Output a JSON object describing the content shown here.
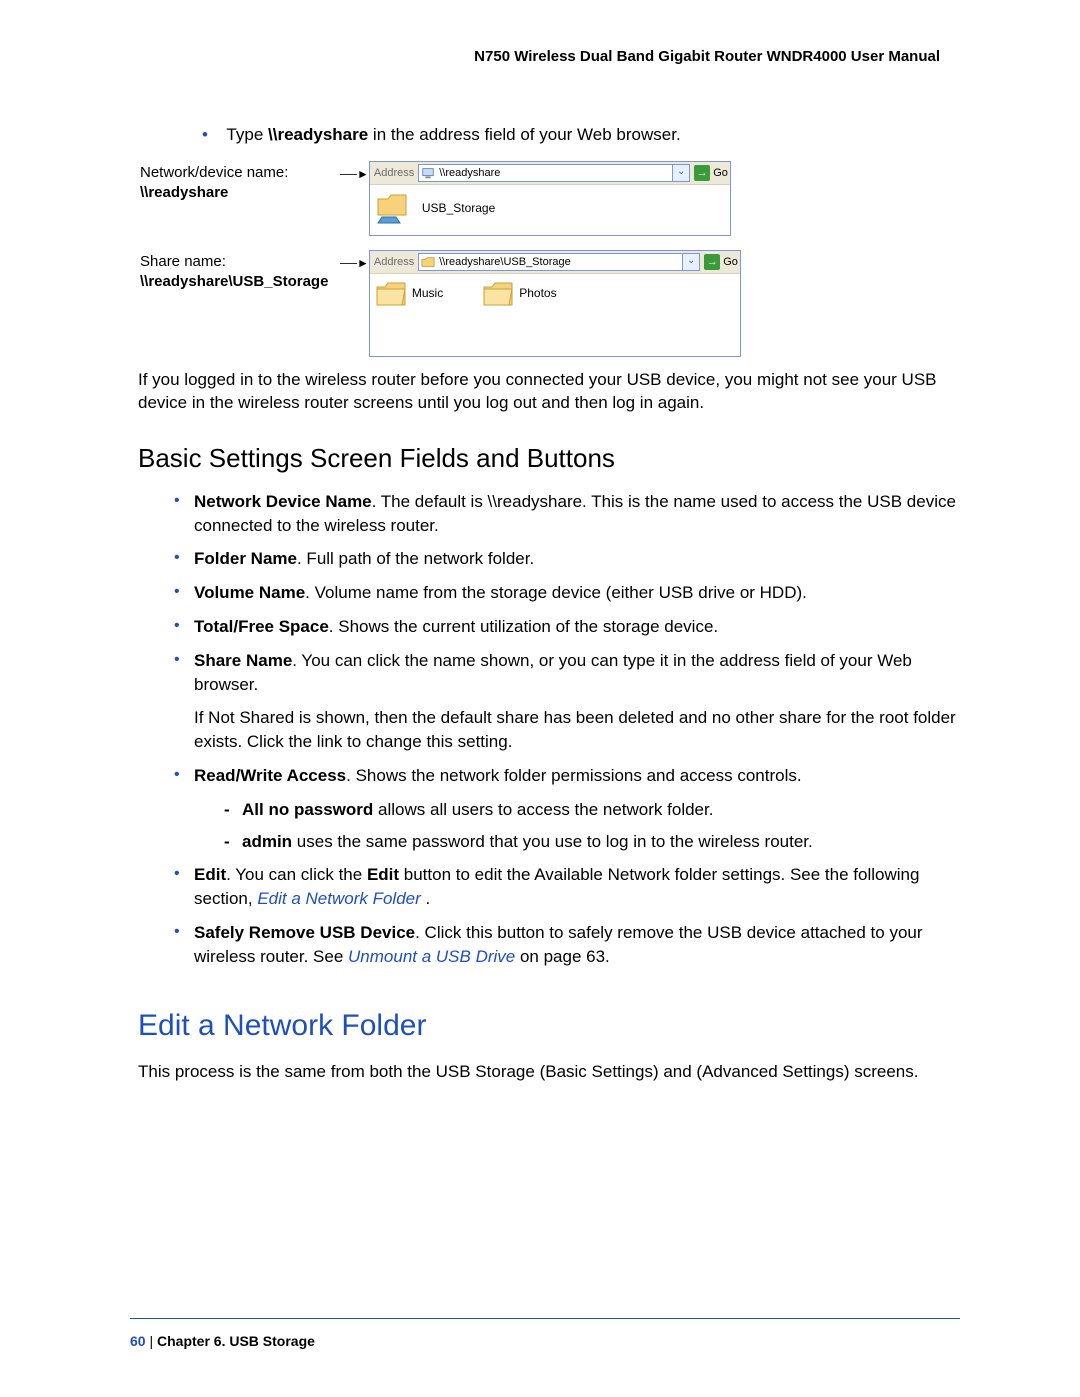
{
  "header": {
    "title": "N750 Wireless Dual Band Gigabit Router WNDR4000 User Manual"
  },
  "intro": {
    "prefix": "Type ",
    "cmd": "\\\\readyshare",
    "suffix": " in the address field of your Web browser."
  },
  "fig1": {
    "label_line1": "Network/device name:",
    "label_line2": "\\\\readyshare",
    "address_label": "Address",
    "address_value": "\\\\readyshare",
    "go": "Go",
    "item": "USB_Storage"
  },
  "fig2": {
    "label_line1": "Share name:",
    "label_line2": "\\\\readyshare\\USB_Storage",
    "address_label": "Address",
    "address_value": "\\\\readyshare\\USB_Storage",
    "go": "Go",
    "item1": "Music",
    "item2": "Photos"
  },
  "post_fig_para": "If you logged in to the wireless router before you connected your USB device, you might not see your USB device in the wireless router screens until you log out and then log in again.",
  "section1": {
    "title": "Basic Settings Screen Fields and Buttons",
    "items": [
      {
        "bold": "Network Device Name",
        "rest": ". The default is \\\\readyshare. This is the name used to access the USB device connected to the wireless router."
      },
      {
        "bold": "Folder Name",
        "rest": ". Full path of the network folder."
      },
      {
        "bold": "Volume Name",
        "rest": ". Volume name from the storage device (either USB drive or HDD)."
      },
      {
        "bold": "Total/Free Space",
        "rest": ". Shows the current utilization of the storage device."
      },
      {
        "bold": "Share Name",
        "rest": ". You can click the name shown, or you can type it in the address field of your Web browser.",
        "subpara": "If Not Shared is shown, then the default share has been deleted and no other share for the root folder exists. Click the link to change this setting."
      },
      {
        "bold": "Read/Write Access",
        "rest": ". Shows the network folder permissions and access controls.",
        "dashes": [
          {
            "bold": "All no password",
            "rest": " allows all users to access the network folder."
          },
          {
            "bold": "admin",
            "rest": " uses the same password that you use to log in to the wireless router."
          }
        ]
      },
      {
        "bold": "Edit",
        "rest_pre": ". You can click the ",
        "rest_bold": "Edit",
        "rest_mid": " button to edit the Available Network folder settings. See the following section, ",
        "link": "Edit a Network Folder ",
        "rest_post": "."
      },
      {
        "bold": "Safely Remove USB Device",
        "rest_pre": ". Click this button to safely remove the USB device attached to your wireless router. See ",
        "link": "Unmount a USB Drive",
        "rest_post": " on page 63."
      }
    ]
  },
  "section2": {
    "title": "Edit a Network Folder",
    "para": "This process is the same from both the USB Storage (Basic Settings) and (Advanced Settings) screens."
  },
  "footer": {
    "page": "60",
    "sep": "   |   ",
    "chapter": "Chapter 6.  USB Storage"
  }
}
